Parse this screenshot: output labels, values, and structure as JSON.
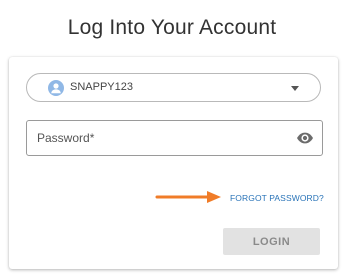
{
  "page": {
    "title": "Log Into Your Account"
  },
  "account_select": {
    "selected_value": "SNAPPY123",
    "avatar_icon": "user-icon",
    "dropdown_icon": "caret-down-icon"
  },
  "password_field": {
    "placeholder": "Password*",
    "value": "",
    "toggle_icon": "eye-icon"
  },
  "annotation": {
    "icon": "arrow-right-icon",
    "color": "#f07c28"
  },
  "links": {
    "forgot_password": "FORGOT PASSWORD?"
  },
  "buttons": {
    "login": "LOGIN",
    "login_state": "disabled"
  },
  "colors": {
    "link": "#2a74b8",
    "button_disabled_bg": "#e2e2e2",
    "button_disabled_text": "#8a8a8a",
    "avatar_bg": "#90b8e6"
  }
}
